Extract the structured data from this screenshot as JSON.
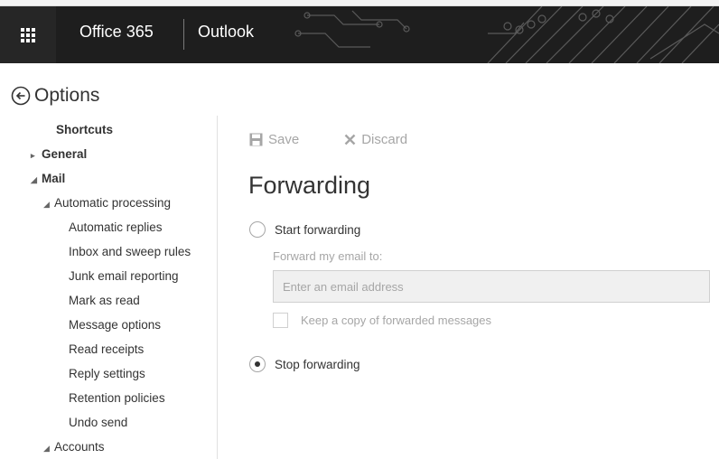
{
  "header": {
    "suite_name": "Office 365",
    "app_name": "Outlook",
    "waffle_icon": "app-launcher-icon"
  },
  "options": {
    "title": "Options",
    "back_icon": "back-arrow-icon"
  },
  "nav": {
    "shortcuts": "Shortcuts",
    "general": "General",
    "mail": "Mail",
    "automatic_processing": "Automatic processing",
    "items": [
      "Automatic replies",
      "Inbox and sweep rules",
      "Junk email reporting",
      "Mark as read",
      "Message options",
      "Read receipts",
      "Reply settings",
      "Retention policies",
      "Undo send"
    ],
    "accounts": "Accounts"
  },
  "toolbar": {
    "save_label": "Save",
    "discard_label": "Discard"
  },
  "forwarding": {
    "heading": "Forwarding",
    "start_label": "Start forwarding",
    "start_selected": false,
    "forward_to_label": "Forward my email to:",
    "email_value": "",
    "email_placeholder": "Enter an email address",
    "keep_copy_label": "Keep a copy of forwarded messages",
    "keep_copy_checked": false,
    "stop_label": "Stop forwarding",
    "stop_selected": true
  },
  "colors": {
    "header_bg": "#1e1e1e",
    "text": "#333333",
    "disabled_text": "#a6a6a6"
  }
}
